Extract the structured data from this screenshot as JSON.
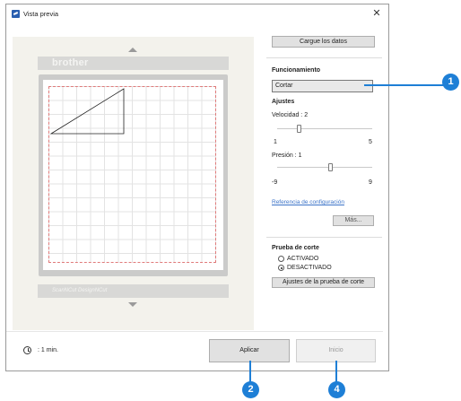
{
  "window": {
    "title": "Vista previa",
    "close_glyph": "✕"
  },
  "preview": {
    "brand_top": "brother",
    "brand_bottom": "ScanNCut  DesignNCut"
  },
  "panel": {
    "load_button": "Cargue los datos",
    "operation": {
      "title": "Funcionamiento",
      "value": "Cortar"
    },
    "settings": {
      "title": "Ajustes",
      "speed": {
        "label": "Velocidad : 2",
        "value": 2,
        "min": "1",
        "max": "5"
      },
      "pressure": {
        "label": "Presión : 1",
        "value": 1,
        "min": "-9",
        "max": "9"
      },
      "reference_link": "Referencia de configuración",
      "more_button": "Más..."
    },
    "test_cut": {
      "title": "Prueba de corte",
      "options": [
        "ACTIVADO",
        "DESACTIVADO"
      ],
      "selected": "DESACTIVADO",
      "settings_button": "Ajustes de la prueba de corte"
    }
  },
  "footer": {
    "time_label": ":  1 min.",
    "apply_button": "Aplicar",
    "start_button": "Inicio"
  },
  "callouts": [
    "1",
    "2",
    "4"
  ],
  "colors": {
    "callout": "#1e7fd6",
    "link": "#3b73c8",
    "cut_line": "#e07a7a"
  }
}
